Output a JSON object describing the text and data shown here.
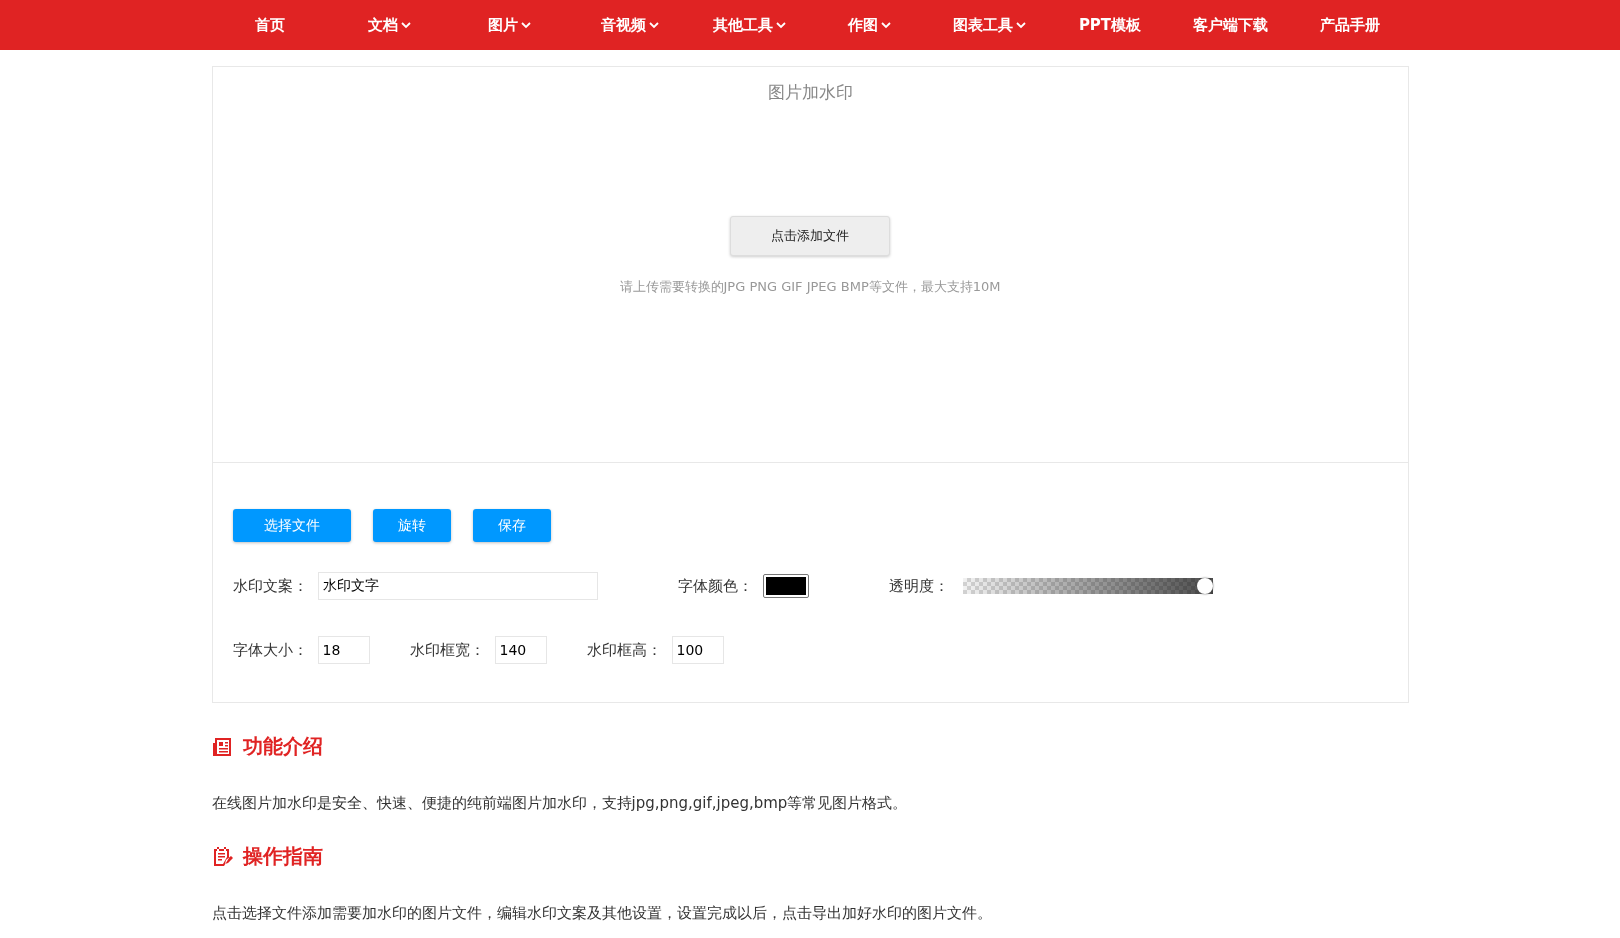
{
  "nav": [
    {
      "label": "首页",
      "has_menu": false
    },
    {
      "label": "文档",
      "has_menu": true
    },
    {
      "label": "图片",
      "has_menu": true
    },
    {
      "label": "音视频",
      "has_menu": true
    },
    {
      "label": "其他工具",
      "has_menu": true
    },
    {
      "label": "作图",
      "has_menu": true
    },
    {
      "label": "图表工具",
      "has_menu": true
    },
    {
      "label": "PPT模板",
      "has_menu": false
    },
    {
      "label": "客户端下载",
      "has_menu": false
    },
    {
      "label": "产品手册",
      "has_menu": false
    }
  ],
  "tool": {
    "title": "图片加水印",
    "add_button": "点击添加文件",
    "hint": "请上传需要转换的JPG PNG GIF JPEG BMP等文件，最大支持10M",
    "buttons": [
      "选择文件",
      "旋转",
      "保存"
    ],
    "watermark_text": {
      "label": "水印文案：",
      "value": "水印文字"
    },
    "font_color": {
      "label": "字体颜色：",
      "color": "#000000"
    },
    "opacity": {
      "label": "透明度：",
      "level": 1
    },
    "sizes": [
      {
        "label": "字体大小：",
        "value": "18"
      },
      {
        "label": "水印框宽：",
        "value": "140"
      },
      {
        "label": "水印框高：",
        "value": "100"
      }
    ]
  },
  "sections": [
    {
      "kind": "intro",
      "heading": "功能介绍",
      "text": "在线图片加水印是安全、快速、便捷的纯前端图片加水印，支持jpg,png,gif,jpeg,bmp等常见图片格式。"
    },
    {
      "kind": "guide",
      "heading": "操作指南",
      "text": "点击选择文件添加需要加水印的图片文件，编辑水印文案及其他设置，设置完成以后，点击导出加好水印的图片文件。"
    }
  ]
}
